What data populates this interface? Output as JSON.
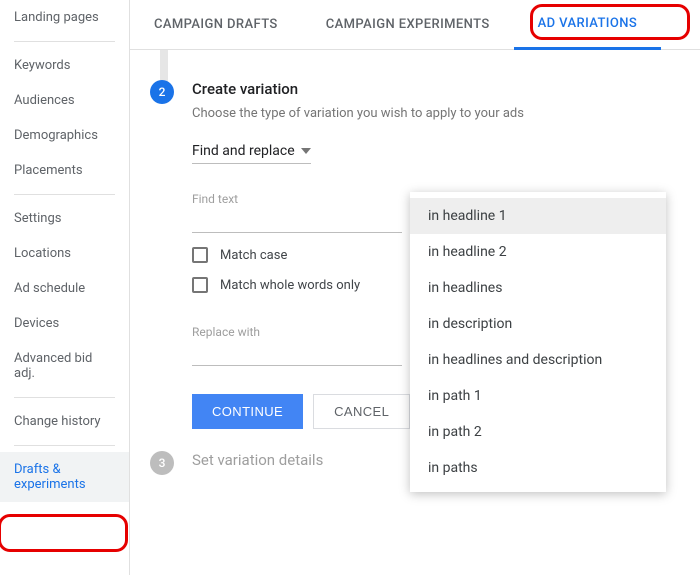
{
  "sidebar": {
    "items": [
      {
        "label": "Landing pages"
      },
      {
        "label": "Keywords"
      },
      {
        "label": "Audiences"
      },
      {
        "label": "Demographics"
      },
      {
        "label": "Placements"
      },
      {
        "label": "Settings"
      },
      {
        "label": "Locations"
      },
      {
        "label": "Ad schedule"
      },
      {
        "label": "Devices"
      },
      {
        "label": "Advanced bid adj."
      },
      {
        "label": "Change history"
      },
      {
        "label": "Drafts & experiments"
      }
    ]
  },
  "tabs": {
    "items": [
      {
        "label": "CAMPAIGN DRAFTS"
      },
      {
        "label": "CAMPAIGN EXPERIMENTS"
      },
      {
        "label": "AD VARIATIONS"
      }
    ]
  },
  "step2": {
    "num": "2",
    "title": "Create variation",
    "desc": "Choose the type of variation you wish to apply to your ads",
    "variation_type": "Find and replace",
    "find_label": "Find text",
    "match_case": "Match case",
    "match_whole": "Match whole words only",
    "replace_label": "Replace with",
    "continue": "CONTINUE",
    "cancel": "CANCEL"
  },
  "step3": {
    "num": "3",
    "title": "Set variation details"
  },
  "dropdown": {
    "options": [
      "in headline 1",
      "in headline 2",
      "in headlines",
      "in description",
      "in headlines and description",
      "in path 1",
      "in path 2",
      "in paths"
    ]
  }
}
